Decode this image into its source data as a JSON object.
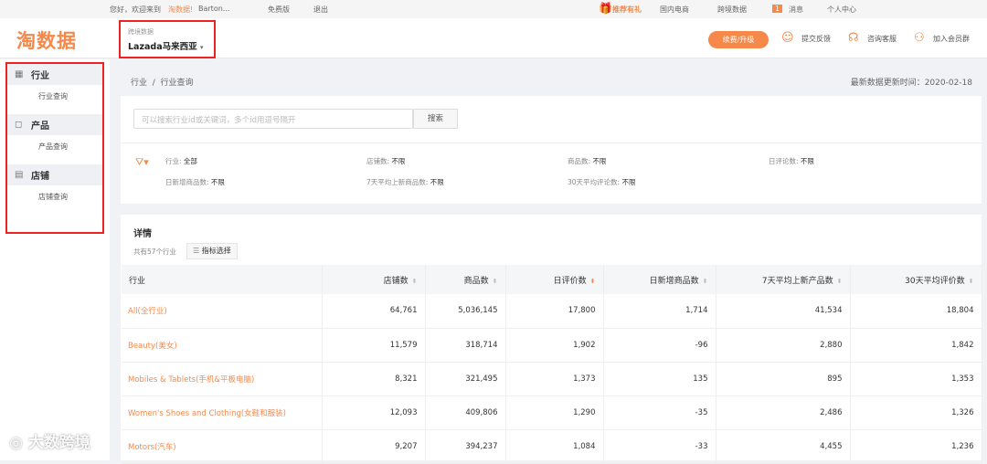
{
  "topbar": {
    "greeting": "您好，欢迎来到",
    "brand": "淘数据!",
    "user": "Barton...",
    "plan": "免费版",
    "logout": "退出",
    "gift": "推荐有礼",
    "domestic": "国内电商",
    "crossborder": "跨境数据",
    "msg_count": "1",
    "messages": "消息",
    "personal": "个人中心"
  },
  "header": {
    "logo": "淘数据",
    "platform_label": "跨境数据",
    "platform_value": "Lazada马来西亚",
    "upgrade": "续费/升级",
    "feedback": "提交反馈",
    "service": "咨询客服",
    "join": "加入会员群"
  },
  "sidebar": [
    {
      "group": "行业",
      "item": "行业查询"
    },
    {
      "group": "产品",
      "item": "产品查询"
    },
    {
      "group": "店铺",
      "item": "店铺查询"
    }
  ],
  "breadcrumb": {
    "root": "行业",
    "sep": "/",
    "current": "行业查询"
  },
  "update": "最新数据更新时间：2020-02-18",
  "search": {
    "placeholder": "可以搜索行业id或关键词，多个id用逗号隔开",
    "button": "搜索"
  },
  "filters": [
    {
      "label": "行业:",
      "value": "全部"
    },
    {
      "label": "店铺数:",
      "value": "不限"
    },
    {
      "label": "商品数:",
      "value": "不限"
    },
    {
      "label": "日评论数:",
      "value": "不限"
    },
    {
      "label": "日新增商品数:",
      "value": "不限"
    },
    {
      "label": "7天平均上新商品数:",
      "value": "不限"
    },
    {
      "label": "30天平均评论数:",
      "value": "不限"
    }
  ],
  "detail": {
    "title": "详情",
    "count": "共有57个行业",
    "metric_button": "指标选择"
  },
  "table": {
    "headers": [
      "行业",
      "店铺数",
      "商品数",
      "日评价数",
      "日新增商品数",
      "7天平均上新产品数",
      "30天平均评价数"
    ],
    "rows": [
      [
        "All(全行业)",
        "64,761",
        "5,036,145",
        "17,800",
        "1,714",
        "41,534",
        "18,804"
      ],
      [
        "Beauty(美女)",
        "11,579",
        "318,714",
        "1,902",
        "-96",
        "2,880",
        "1,842"
      ],
      [
        "Mobiles & Tablets(手机&平板电脑)",
        "8,321",
        "321,495",
        "1,373",
        "135",
        "895",
        "1,353"
      ],
      [
        "Women's Shoes and Clothing(女鞋和服装)",
        "12,093",
        "409,806",
        "1,290",
        "-35",
        "2,486",
        "1,326"
      ],
      [
        "Motors(汽车)",
        "9,207",
        "394,237",
        "1,084",
        "-33",
        "4,455",
        "1,236"
      ]
    ]
  },
  "watermark": "大数跨境"
}
